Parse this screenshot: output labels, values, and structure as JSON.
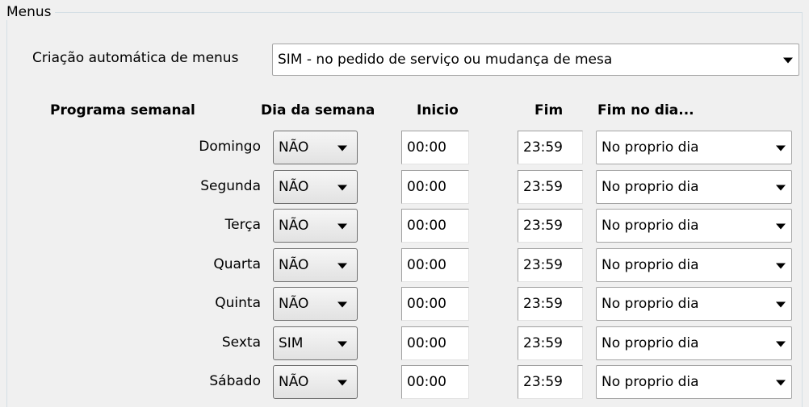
{
  "group": {
    "title": "Menus"
  },
  "auto_menu": {
    "label": "Criação automática de menus",
    "value": "SIM - no pedido de serviço ou mudança de mesa"
  },
  "headers": {
    "programa": "Programa semanal",
    "dia": "Dia da semana",
    "inicio": "Inicio",
    "fim": "Fim",
    "fim_dia": "Fim no dia..."
  },
  "rows": [
    {
      "day": "Domingo",
      "enabled": "NÃO",
      "start": "00:00",
      "end": "23:59",
      "end_day": "No proprio dia"
    },
    {
      "day": "Segunda",
      "enabled": "NÃO",
      "start": "00:00",
      "end": "23:59",
      "end_day": "No proprio dia"
    },
    {
      "day": "Terça",
      "enabled": "NÃO",
      "start": "00:00",
      "end": "23:59",
      "end_day": "No proprio dia"
    },
    {
      "day": "Quarta",
      "enabled": "NÃO",
      "start": "00:00",
      "end": "23:59",
      "end_day": "No proprio dia"
    },
    {
      "day": "Quinta",
      "enabled": "NÃO",
      "start": "00:00",
      "end": "23:59",
      "end_day": "No proprio dia"
    },
    {
      "day": "Sexta",
      "enabled": "SIM",
      "start": "00:00",
      "end": "23:59",
      "end_day": "No proprio dia"
    },
    {
      "day": "Sábado",
      "enabled": "NÃO",
      "start": "00:00",
      "end": "23:59",
      "end_day": "No proprio dia"
    }
  ]
}
